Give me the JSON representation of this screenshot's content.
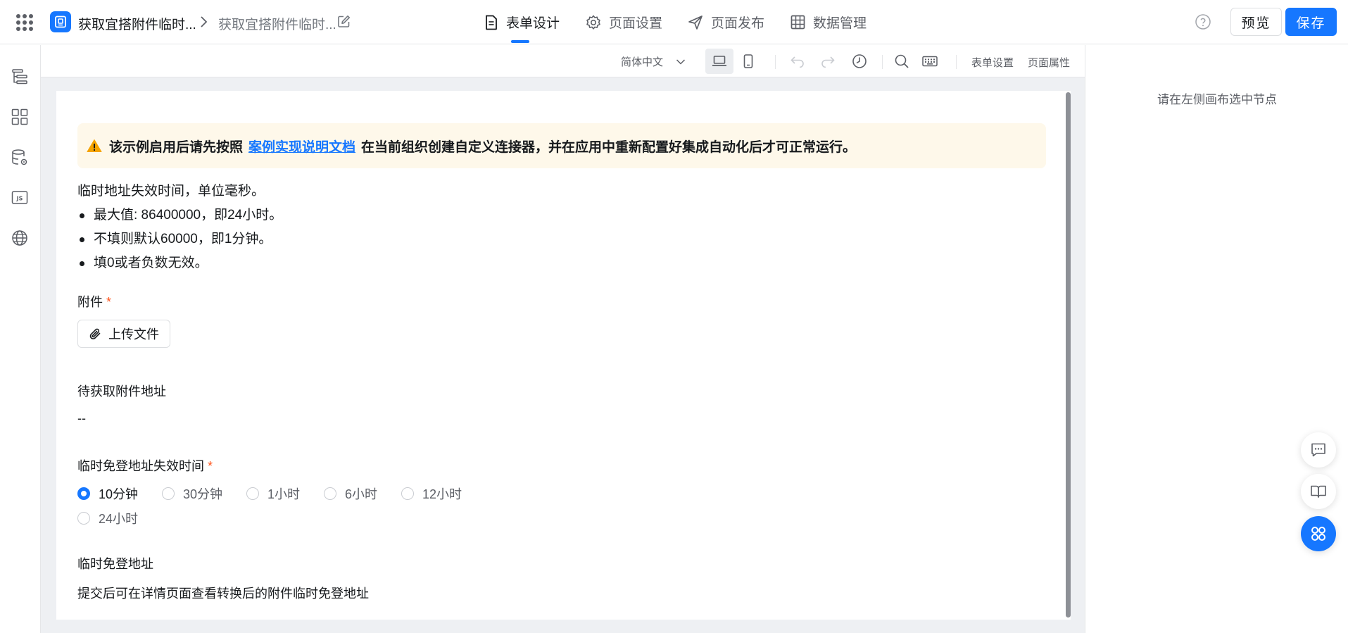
{
  "header": {
    "app_name": "获取宜搭附件临时...",
    "page_name": "获取宜搭附件临时...",
    "tabs": [
      {
        "label": "表单设计",
        "icon": "document-icon"
      },
      {
        "label": "页面设置",
        "icon": "gear-icon"
      },
      {
        "label": "页面发布",
        "icon": "send-icon"
      },
      {
        "label": "数据管理",
        "icon": "table-icon"
      }
    ],
    "active_tab": "表单设计",
    "preview_label": "预览",
    "save_label": "保存"
  },
  "sidebar": {
    "items": [
      {
        "icon": "outline-tree-icon"
      },
      {
        "icon": "components-grid-icon"
      },
      {
        "icon": "datasource-icon"
      },
      {
        "icon": "js-code-icon"
      },
      {
        "icon": "globe-icon"
      }
    ]
  },
  "toolbar": {
    "language": "简体中文",
    "form_settings_label": "表单设置",
    "page_props_label": "页面属性"
  },
  "form": {
    "alert": {
      "prefix": "该示例启用后请先按照",
      "link_text": "案例实现说明文档",
      "suffix": "在当前组织创建自定义连接器，并在应用中重新配置好集成自动化后才可正常运行。"
    },
    "desc_title": "临时地址失效时间，单位毫秒。",
    "desc_items": [
      "最大值: 86400000，即24小时。",
      "不填则默认60000，即1分钟。",
      "填0或者负数无效。"
    ],
    "attachment_label": "附件",
    "upload_label": "上传文件",
    "pending_label": "待获取附件地址",
    "pending_value": "--",
    "expire_label": "临时免登地址失效时间",
    "expire_options": [
      "10分钟",
      "30分钟",
      "1小时",
      "6小时",
      "12小时",
      "24小时"
    ],
    "expire_selected": "10分钟",
    "temp_url_label": "临时免登地址",
    "temp_url_value": "提交后可在详情页面查看转换后的附件临时免登地址"
  },
  "right_panel": {
    "hint": "请在左侧画布选中节点"
  },
  "colors": {
    "primary": "#1677ff",
    "required": "#ff5219",
    "alert_bg": "#fef8ea",
    "warning": "#f5a300"
  }
}
